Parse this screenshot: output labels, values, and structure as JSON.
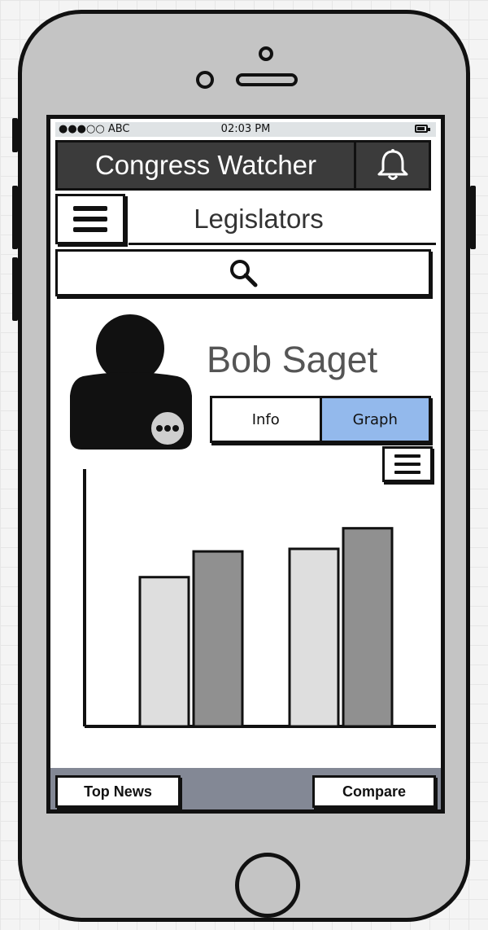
{
  "status_bar": {
    "carrier": "●●●○○ ABC",
    "time": "02:03 PM"
  },
  "header": {
    "title": "Congress Watcher"
  },
  "subheader": {
    "title": "Legislators"
  },
  "profile": {
    "name": "Bob Saget"
  },
  "tabs": [
    {
      "label": "Info",
      "active": false
    },
    {
      "label": "Graph",
      "active": true
    }
  ],
  "chart_data": {
    "type": "bar",
    "categories": [
      "",
      ""
    ],
    "series": [
      {
        "values": [
          58,
          69
        ],
        "color": "#dedede"
      },
      {
        "values": [
          68,
          77
        ],
        "color": "#909090"
      }
    ],
    "ylim": [
      0,
      100
    ],
    "xlabel": "",
    "ylabel": "",
    "grid": false
  },
  "bottom_nav": {
    "left": "Top News",
    "right": "Compare"
  },
  "colors": {
    "header_bg": "#3b3b3b",
    "tab_active": "#93b9ec",
    "bottom_nav_bg": "#838895",
    "device_body": "#c4c4c4"
  },
  "icons": {
    "header_right": "bell-icon",
    "menu": "hamburger-menu-icon",
    "search": "search-icon",
    "avatar": "user-avatar-icon",
    "avatar_badge": "more-options-icon",
    "chart_menu": "hamburger-menu-icon"
  }
}
